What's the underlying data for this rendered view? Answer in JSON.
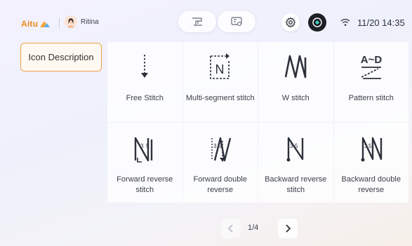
{
  "header": {
    "brand": "Aitu",
    "username": "Ritina",
    "time": "11/20 14:35",
    "icons": [
      "machine-icon",
      "display-icon",
      "gear-icon",
      "power-icon",
      "wifi-icon"
    ]
  },
  "sidebar": {
    "tab_label": "Icon Description"
  },
  "grid": {
    "items": [
      {
        "label": "Free Stitch",
        "icon": "free-stitch-icon"
      },
      {
        "label": "Multi-segment stitch",
        "icon": "multi-segment-icon"
      },
      {
        "label": "W stitch",
        "icon": "w-stitch-icon"
      },
      {
        "label": "Pattern stitch",
        "icon": "pattern-stitch-icon"
      },
      {
        "label": "Forward reverse stitch",
        "icon": "forward-reverse-icon"
      },
      {
        "label": "Forward double reverse",
        "icon": "forward-double-reverse-icon"
      },
      {
        "label": "Backward reverse stitch",
        "icon": "backward-reverse-icon"
      },
      {
        "label": "Backward double reverse",
        "icon": "backward-double-reverse-icon"
      }
    ],
    "icon_text": {
      "multi_segment_letter": "N",
      "pattern_top": "A~D",
      "num_3": "3",
      "num_5": "5"
    }
  },
  "pager": {
    "page_text": "1/4"
  },
  "colors": {
    "accent": "#eaa24a",
    "brand": "#e98a18"
  }
}
